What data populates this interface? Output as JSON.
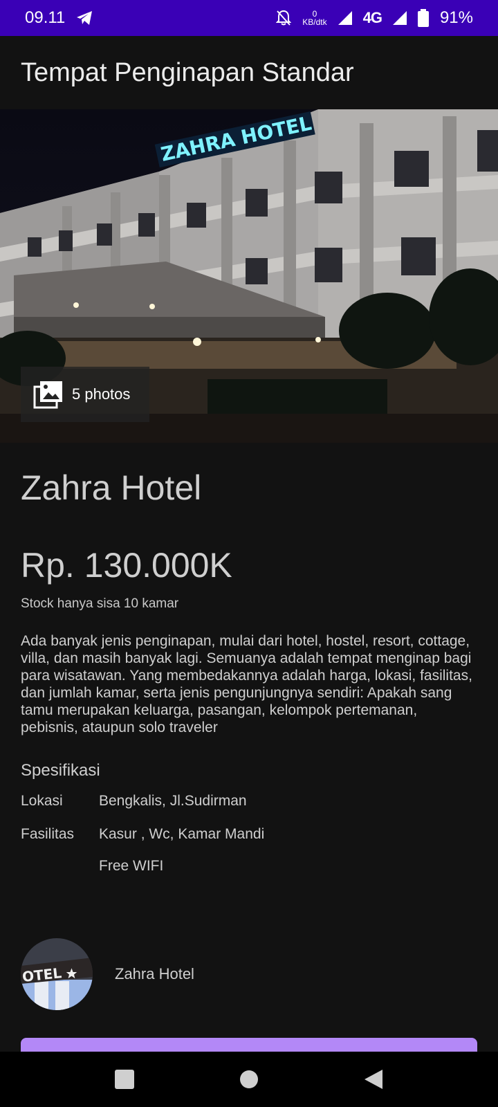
{
  "status_bar": {
    "time": "09.11",
    "net_speed_value": "0",
    "net_speed_unit": "KB/dtk",
    "network": "4G",
    "battery": "91%"
  },
  "app_bar": {
    "title": "Tempat Penginapan Standar"
  },
  "hero": {
    "photo_count_label": "5 photos",
    "sign_text": "ZAHRA HOTEL"
  },
  "hotel": {
    "name": "Zahra Hotel",
    "price": "Rp. 130.000K",
    "stock": "Stock hanya sisa 10 kamar",
    "description": "Ada banyak jenis penginapan, mulai dari hotel, hostel, resort, cottage, villa, dan masih banyak lagi. Semuanya adalah tempat menginap bagi para wisatawan. Yang membedakannya adalah harga, lokasi, fasilitas, dan jumlah kamar, serta jenis pengunjungnya sendiri: Apakah sang tamu merupakan keluarga, pasangan, kelompok pertemanan, pebisnis, ataupun solo traveler"
  },
  "specs": {
    "title": "Spesifikasi",
    "location_label": "Lokasi",
    "location_value": "Bengkalis, Jl.Sudirman",
    "facilities_label": "Fasilitas",
    "facilities_value": "Kasur , Wc, Kamar Mandi",
    "facilities_extra": "Free WIFI"
  },
  "owner": {
    "name": "Zahra Hotel",
    "avatar_text": "OTEL"
  },
  "colors": {
    "status_bar": "#3a00b6",
    "background": "#121212",
    "cta": "#b388f7"
  },
  "icons": {
    "telegram": "telegram-icon",
    "bell_off": "bell-off-icon",
    "signal": "signal-icon",
    "battery": "battery-icon",
    "photos": "image-icon",
    "nav_recent": "square-icon",
    "nav_home": "circle-icon",
    "nav_back": "triangle-back-icon"
  }
}
